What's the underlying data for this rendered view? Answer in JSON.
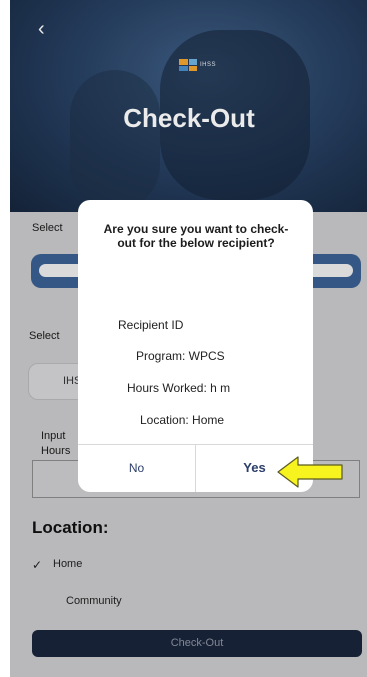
{
  "header": {
    "back_icon": "chevron-left-icon",
    "back_glyph": "‹",
    "logo_text": "IHSS",
    "title": "Check-Out"
  },
  "form": {
    "select_label_1": "Select",
    "select_label_2": "Select",
    "chip_text": "IHS",
    "input_label": "Input",
    "hours_label": "Hours",
    "location_title": "Location:",
    "check_glyph": "✓",
    "location_options": [
      "Home",
      "Community"
    ],
    "checkout_button": "Check-Out"
  },
  "dialog": {
    "question": "Are you sure you want to check-out for the below recipient?",
    "recipient_id": "Recipient ID",
    "program": "Program: WPCS",
    "hours_worked": "Hours Worked: h m",
    "location": "Location: Home",
    "no_label": "No",
    "yes_label": "Yes"
  },
  "annotation": {
    "arrow_icon": "yellow-arrow-icon",
    "color": "#f7f31f"
  },
  "colors": {
    "header_blue": "#243c5d",
    "pill_blue": "#3a5f92",
    "button_navy": "#18243b",
    "dialog_text_blue": "#2c3e6a"
  }
}
